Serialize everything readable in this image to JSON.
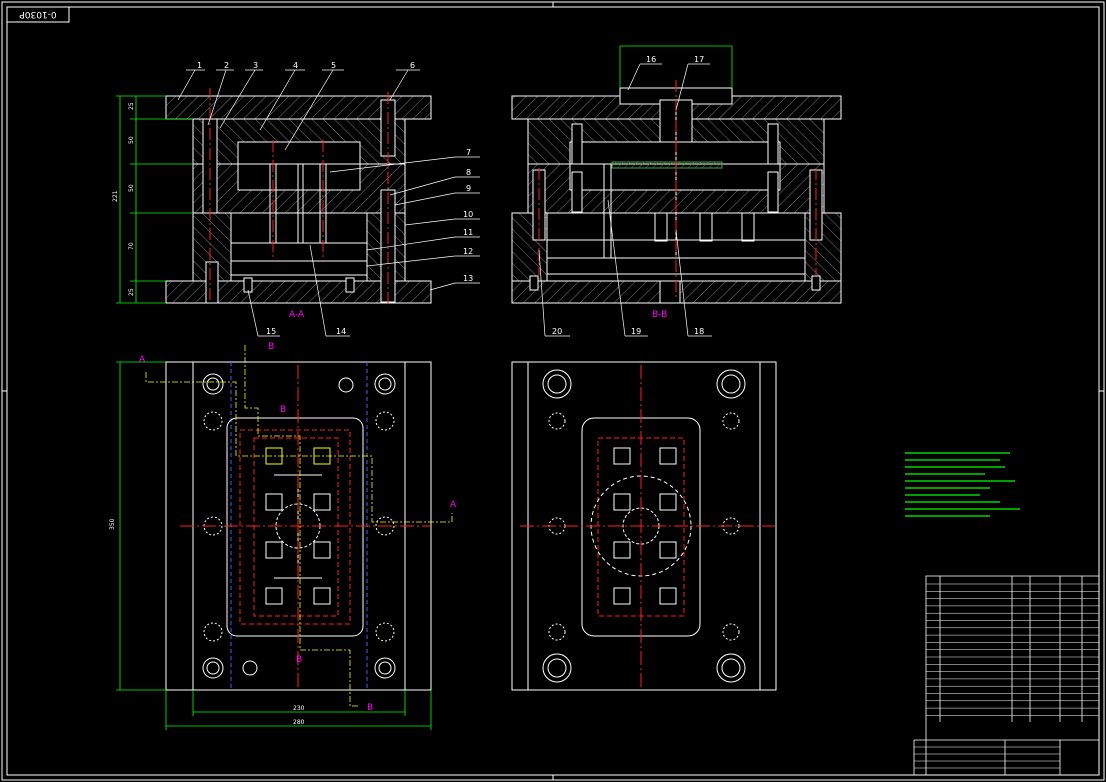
{
  "drawing": {
    "code": "0-1030P",
    "sections": {
      "aa": "A-A",
      "bb": "B-B"
    },
    "cut_letters": {
      "a": "A",
      "b": "B"
    },
    "part_numbers_left": [
      "1",
      "2",
      "3",
      "4",
      "5",
      "6",
      "7",
      "8",
      "9",
      "10",
      "11",
      "12",
      "13",
      "14",
      "15"
    ],
    "part_numbers_right": [
      "16",
      "17",
      "18",
      "19",
      "20"
    ],
    "dims": {
      "h25_top": "25",
      "h50_a": "50",
      "h50_b": "50",
      "h70": "70",
      "h25_bot": "25",
      "total": "221",
      "left_height": "350",
      "inner_width": "230",
      "outer_width": "280"
    },
    "colors": {
      "background": "#000000",
      "line": "#ffffff",
      "centerline": "#ff2020",
      "dim": "#00ff00",
      "hidden": "#4060ff",
      "cutline": "#ffff00",
      "section_label": "#ff00ff",
      "number_text": "#ffffff"
    }
  }
}
